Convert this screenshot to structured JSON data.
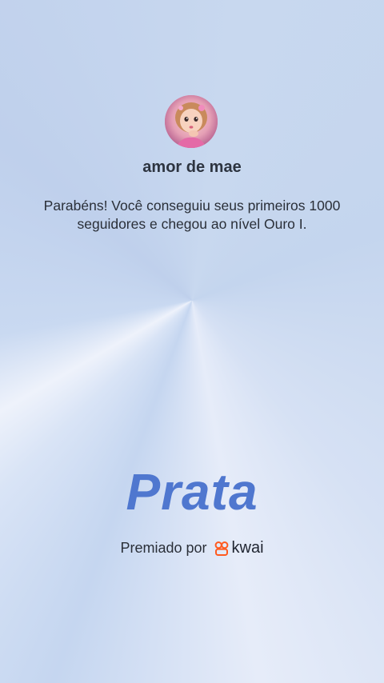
{
  "profile": {
    "username": "amor de mae",
    "avatar_icon": "avatar-girl-photo"
  },
  "message": "Parabéns! Você conseguiu seus primeiros 1000 seguidores e chegou ao nível Ouro I.",
  "level": {
    "title": "Prata",
    "color": "#4f77cf"
  },
  "awarded": {
    "label": "Premiado por",
    "brand_icon": "kwai-logo-icon",
    "brand_name": "kwai",
    "brand_color": "#ff5a1f"
  }
}
